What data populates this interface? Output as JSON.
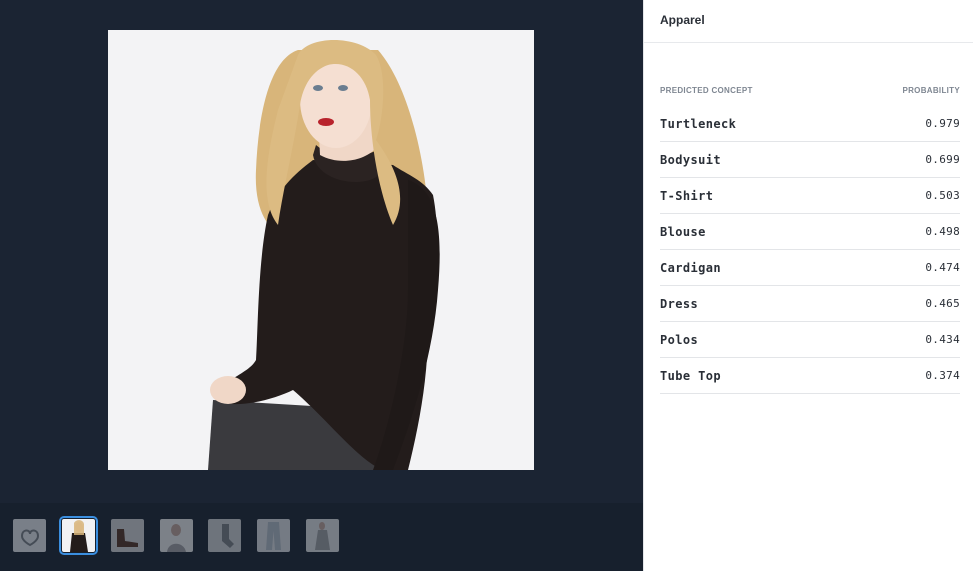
{
  "panel": {
    "model_title": "Apparel",
    "table": {
      "header_concept": "PREDICTED CONCEPT",
      "header_probability": "PROBABILITY",
      "rows": [
        {
          "concept": "Turtleneck",
          "probability": "0.979"
        },
        {
          "concept": "Bodysuit",
          "probability": "0.699"
        },
        {
          "concept": "T-Shirt",
          "probability": "0.503"
        },
        {
          "concept": "Blouse",
          "probability": "0.498"
        },
        {
          "concept": "Cardigan",
          "probability": "0.474"
        },
        {
          "concept": "Dress",
          "probability": "0.465"
        },
        {
          "concept": "Polos",
          "probability": "0.434"
        },
        {
          "concept": "Tube Top",
          "probability": "0.374"
        }
      ]
    }
  },
  "viewer": {
    "selected_thumbnail": 2,
    "thumbnail_count": 7
  },
  "colors": {
    "viewer_background": "#1b2433",
    "thumbnail_strip": "#17202d",
    "selection_outline": "#3b8fe0",
    "text_primary": "#2a2f37",
    "text_muted": "#7f8792"
  }
}
